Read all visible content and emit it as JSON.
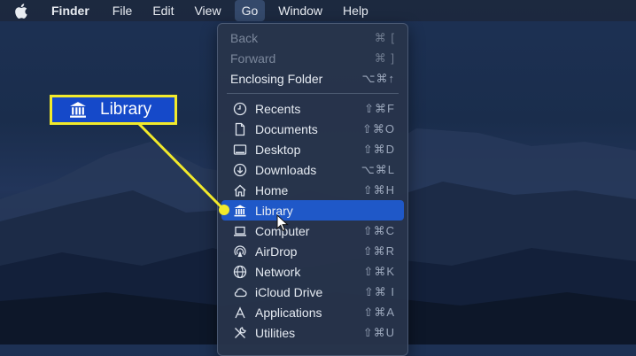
{
  "menubar": {
    "app_name": "Finder",
    "items": [
      "File",
      "Edit",
      "View",
      "Go",
      "Window",
      "Help"
    ],
    "active_item": "Go"
  },
  "go_menu": {
    "top_items": [
      {
        "label": "Back",
        "shortcut": "⌘ [",
        "disabled": true
      },
      {
        "label": "Forward",
        "shortcut": "⌘ ]",
        "disabled": true
      },
      {
        "label": "Enclosing Folder",
        "shortcut": "⌥⌘↑",
        "disabled": false
      }
    ],
    "items": [
      {
        "label": "Recents",
        "shortcut": "⇧⌘F",
        "icon": "clock-icon"
      },
      {
        "label": "Documents",
        "shortcut": "⇧⌘O",
        "icon": "document-icon"
      },
      {
        "label": "Desktop",
        "shortcut": "⇧⌘D",
        "icon": "desktop-icon"
      },
      {
        "label": "Downloads",
        "shortcut": "⌥⌘L",
        "icon": "download-icon"
      },
      {
        "label": "Home",
        "shortcut": "⇧⌘H",
        "icon": "house-icon"
      },
      {
        "label": "Library",
        "shortcut": "",
        "icon": "library-icon",
        "selected": true
      },
      {
        "label": "Computer",
        "shortcut": "⇧⌘C",
        "icon": "laptop-icon"
      },
      {
        "label": "AirDrop",
        "shortcut": "⇧⌘R",
        "icon": "airdrop-icon"
      },
      {
        "label": "Network",
        "shortcut": "⇧⌘K",
        "icon": "globe-icon"
      },
      {
        "label": "iCloud Drive",
        "shortcut": "⇧⌘ I",
        "icon": "cloud-icon"
      },
      {
        "label": "Applications",
        "shortcut": "⇧⌘A",
        "icon": "applications-icon"
      },
      {
        "label": "Utilities",
        "shortcut": "⇧⌘U",
        "icon": "tools-icon"
      }
    ]
  },
  "callout": {
    "label": "Library",
    "icon": "library-icon"
  },
  "colors": {
    "highlight": "#1f58c8",
    "callout_border": "#f2ea2b",
    "callout_fill": "#1549c9"
  }
}
